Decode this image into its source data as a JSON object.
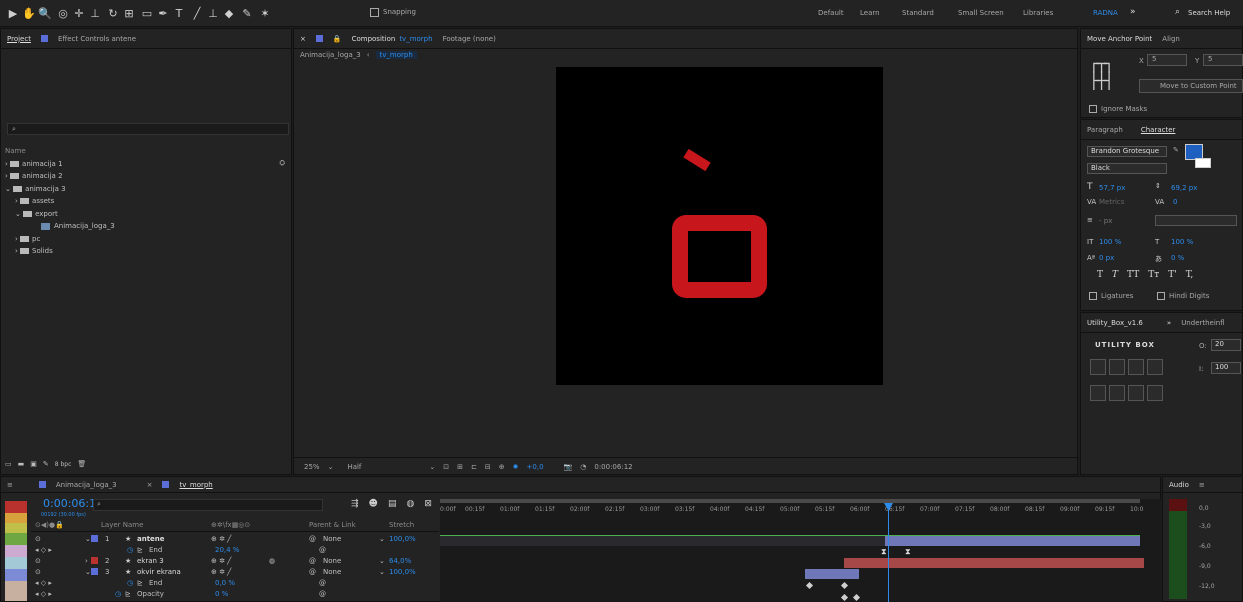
{
  "toolbar": {
    "snapping": "Snapping",
    "workspaces": [
      "Default",
      "Learn",
      "Standard",
      "Small Screen",
      "Libraries"
    ],
    "active_workspace": "RADNA",
    "search_help": "Search Help"
  },
  "project": {
    "tab": "Project",
    "effect_controls": "Effect Controls antene",
    "name_header": "Name",
    "items": [
      "animacija 1",
      "animacija 2",
      "animacija 3",
      "assets",
      "export",
      "Animacija_loga_3",
      "pc",
      "Solids"
    ],
    "footer_bpc": "8 bpc"
  },
  "composition": {
    "tab_prefix": "Composition",
    "tab_name": "tv_morph",
    "footage": "Footage (none)",
    "breadcrumb": [
      "Animacija_loga_3",
      "tv_morph"
    ],
    "zoom": "25%",
    "resolution": "Half",
    "exposure": "+0,0",
    "timecode": "0:00:06:12"
  },
  "anchor": {
    "title": "Move Anchor Point",
    "align": "Align",
    "x_label": "X",
    "x": "5",
    "y_label": "Y",
    "y": "5",
    "button": "Move to Custom Point",
    "ignore_masks": "Ignore Masks"
  },
  "character": {
    "paragraph": "Paragraph",
    "title": "Character",
    "font": "Brandon Grotesque",
    "style": "Black",
    "size": "57,7 px",
    "leading": "69,2 px",
    "kerning": "Metrics",
    "tracking": "0",
    "stroke": "- px",
    "vscale": "100 %",
    "hscale": "100 %",
    "baseline": "0 px",
    "tsume": "0 %",
    "styles": [
      "T",
      "T",
      "TT",
      "Tт",
      "T'",
      "T,"
    ],
    "ligatures": "Ligatures",
    "hindi": "Hindi Digits"
  },
  "utility": {
    "tab": "Utility_Box_v1.6",
    "tab2": "Undertheinfl",
    "logo": "UTILITY BOX",
    "o_label": "O:",
    "o": "20",
    "i_label": "I:",
    "i": "100"
  },
  "audio": {
    "tab": "Audio",
    "levels": [
      "0,0",
      "-3,0",
      "-6,0",
      "-9,0",
      "-12,0"
    ]
  },
  "timeline": {
    "tabs": [
      "Animacija_loga_3",
      "tv_morph"
    ],
    "timecode": "0:00:06:12",
    "frames": "00192 (30.00 fps)",
    "col_layer": "Layer Name",
    "col_parent": "Parent & Link",
    "col_stretch": "Stretch",
    "ruler": [
      "0:00f",
      "00:15f",
      "01:00f",
      "01:15f",
      "02:00f",
      "02:15f",
      "03:00f",
      "03:15f",
      "04:00f",
      "04:15f",
      "05:00f",
      "05:15f",
      "06:00f",
      "06:15f",
      "07:00f",
      "07:15f",
      "08:00f",
      "08:15f",
      "09:00f",
      "09:15f",
      "10:0"
    ],
    "layers": [
      {
        "num": "1",
        "name": "antene",
        "parent": "None",
        "stretch": "100,0%",
        "kind": "layer"
      },
      {
        "num": "",
        "name": "End",
        "parent": "",
        "stretch": "",
        "value": "20,4 %",
        "kind": "prop"
      },
      {
        "num": "2",
        "name": "ekran 3",
        "parent": "None",
        "stretch": "64,0%",
        "kind": "layer"
      },
      {
        "num": "3",
        "name": "okvir ekrana",
        "parent": "None",
        "stretch": "100,0%",
        "kind": "layer"
      },
      {
        "num": "",
        "name": "End",
        "parent": "",
        "stretch": "",
        "value": "0,0 %",
        "kind": "prop"
      },
      {
        "num": "",
        "name": "Opacity",
        "parent": "",
        "stretch": "",
        "value": "0 %",
        "kind": "prop"
      }
    ]
  },
  "colors": {
    "accent": "#2d8ceb",
    "logo_red": "#c8161d",
    "swatch_blue": "#1f5fbf"
  }
}
